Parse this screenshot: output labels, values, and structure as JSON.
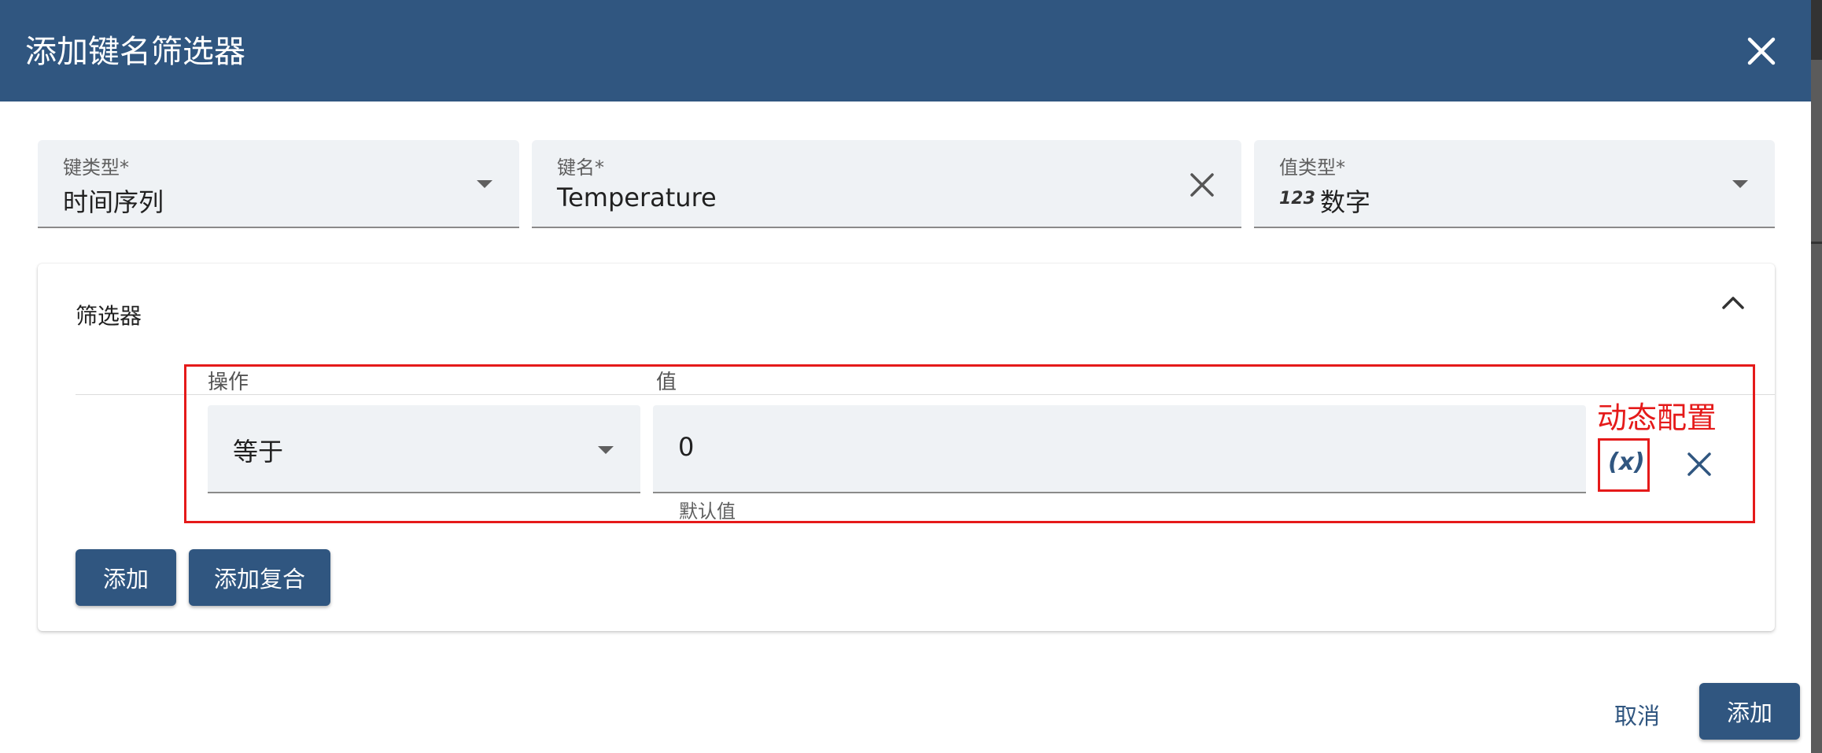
{
  "dialog": {
    "title": "添加键名筛选器"
  },
  "fields": {
    "key_type": {
      "label": "键类型*",
      "value": "时间序列"
    },
    "key_name": {
      "label": "键名*",
      "value": "Temperature"
    },
    "value_type": {
      "label": "值类型*",
      "icon_text": "123",
      "value": "数字"
    }
  },
  "filters": {
    "title": "筛选器",
    "operation_label": "操作",
    "value_label": "值",
    "operation_value": "等于",
    "value_value": "0",
    "value_hint": "默认值",
    "dynamic_button_text": "(x)",
    "annotation": "动态配置"
  },
  "buttons": {
    "add": "添加",
    "add_complex": "添加复合",
    "cancel": "取消",
    "submit": "添加"
  },
  "colors": {
    "primary": "#305680",
    "highlight": "#e51a1a",
    "field_bg": "#eff2f5"
  }
}
